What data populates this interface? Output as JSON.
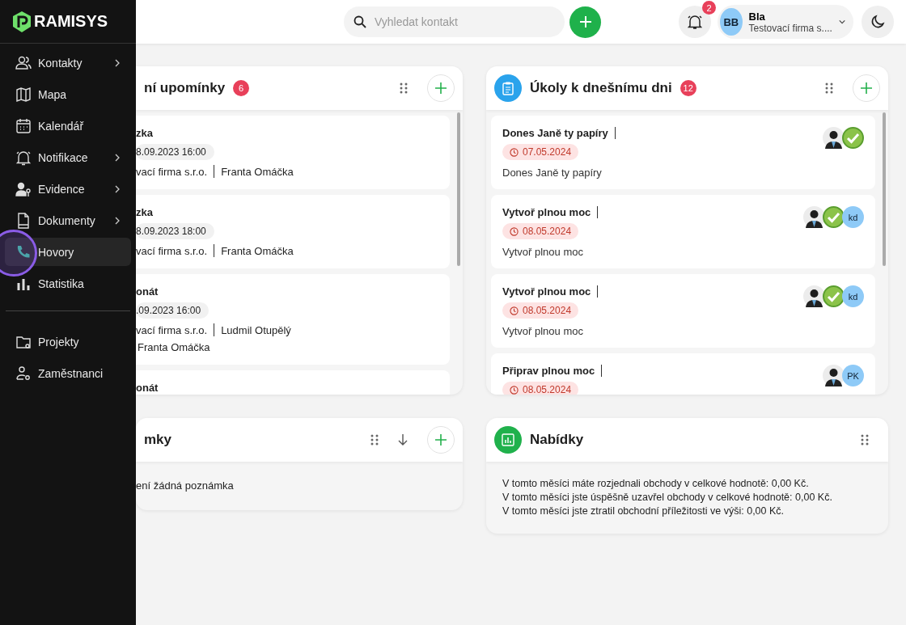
{
  "sidebar": {
    "logo": "RAMISYS",
    "groups": [
      {
        "items": [
          {
            "label": "Kontakty",
            "submenu": true,
            "selected": false
          },
          {
            "label": "Mapa",
            "submenu": false,
            "selected": false
          },
          {
            "label": "Kalendář",
            "submenu": false,
            "selected": false
          },
          {
            "label": "Notifikace",
            "submenu": true,
            "selected": false
          },
          {
            "label": "Evidence",
            "submenu": true,
            "selected": false
          },
          {
            "label": "Dokumenty",
            "submenu": true,
            "selected": false
          },
          {
            "label": "Hovory",
            "submenu": false,
            "selected": true
          },
          {
            "label": "Statistika",
            "submenu": false,
            "selected": false
          }
        ]
      },
      {
        "items": [
          {
            "label": "Projekty",
            "submenu": false,
            "selected": false
          },
          {
            "label": "Zaměstnanci",
            "submenu": false,
            "selected": false
          }
        ]
      }
    ]
  },
  "topbar": {
    "search": {
      "placeholder": "Vyhledat kontakt"
    },
    "notifications": "2",
    "user": {
      "initials": "BB",
      "name": "Bla",
      "company": "Testovací firma s...."
    }
  },
  "reminders": {
    "title": "ní upomínky",
    "count": "6",
    "items": [
      {
        "title": "zka",
        "datetime": "8.09.2023 16:00",
        "company": "vací firma s.r.o.",
        "person": "Franta Omáčka"
      },
      {
        "title": "zka",
        "datetime": "8.09.2023 18:00",
        "company": "vací firma s.r.o.",
        "person": "Franta Omáčka"
      },
      {
        "title": "onát",
        "datetime": ".09.2023 16:00",
        "company": "vací firma s.r.o.",
        "person": "Ludmil Otupělý",
        "extra": "Franta Omáčka"
      },
      {
        "title": "onát"
      }
    ]
  },
  "tasks": {
    "title": "Úkoly k dnešnímu dni",
    "count": "12",
    "items": [
      {
        "title": "Dones Janě ty papíry",
        "date": "07.05.2024",
        "description": "Dones Janě ty papíry",
        "assignees": [
          {
            "kind": "photo"
          },
          {
            "kind": "check"
          }
        ]
      },
      {
        "title": "Vytvoř plnou moc",
        "date": "08.05.2024",
        "description": "Vytvoř plnou moc",
        "assignees": [
          {
            "kind": "photo"
          },
          {
            "kind": "check"
          },
          {
            "kind": "initials",
            "text": "kd"
          }
        ]
      },
      {
        "title": "Vytvoř plnou moc",
        "date": "08.05.2024",
        "description": "Vytvoř plnou moc",
        "assignees": [
          {
            "kind": "photo"
          },
          {
            "kind": "check"
          },
          {
            "kind": "initials",
            "text": "kd"
          }
        ]
      },
      {
        "title": "Připrav plnou moc",
        "date": "08.05.2024",
        "assignees": [
          {
            "kind": "photo"
          },
          {
            "kind": "initials",
            "text": "PK"
          }
        ]
      }
    ]
  },
  "notes": {
    "title": "mky",
    "empty_text": "ení žádná poznámka"
  },
  "offers": {
    "title": "Nabídky",
    "lines": [
      "V tomto měsíci máte rozjednali obchody v celkové hodnotě: 0,00 Kč.",
      "V tomto měsíci jste úspěšně uzavřel obchody v celkové hodnotě: 0,00 Kč.",
      "V tomto měsíci jste ztratil obchodní příležitosti ve výši: 0,00 Kč."
    ]
  }
}
